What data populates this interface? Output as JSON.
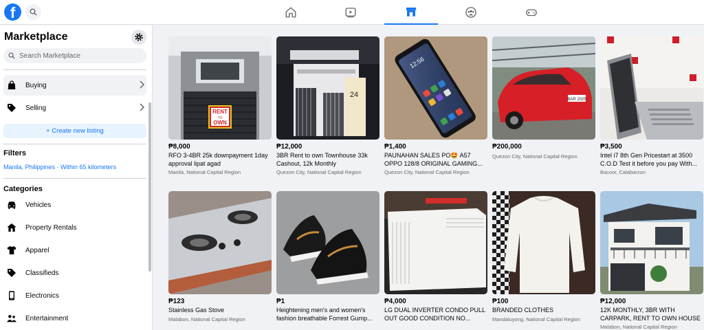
{
  "sidebar": {
    "title": "Marketplace",
    "search_placeholder": "Search Marketplace",
    "nav": [
      {
        "label": "Buying"
      },
      {
        "label": "Selling"
      }
    ],
    "create_listing": "+ Create new listing",
    "filters_heading": "Filters",
    "location": "Manila, Philippines · Within 65 kilometers",
    "categories_heading": "Categories",
    "categories": [
      {
        "label": "Vehicles",
        "icon": "car-icon"
      },
      {
        "label": "Property Rentals",
        "icon": "house-icon"
      },
      {
        "label": "Apparel",
        "icon": "shirt-icon"
      },
      {
        "label": "Classifieds",
        "icon": "tag-icon"
      },
      {
        "label": "Electronics",
        "icon": "phone-icon"
      },
      {
        "label": "Entertainment",
        "icon": "people-icon"
      }
    ]
  },
  "nav_tabs": [
    "home",
    "watch",
    "marketplace",
    "groups",
    "gaming"
  ],
  "colors": {
    "accent": "#1877f2",
    "page_bg": "#f0f2f5",
    "secondary_text": "#65676b"
  },
  "listings": [
    {
      "price": "₱8,000",
      "title": "RFO 3-4BR 25k downpayment 1day approval lipat agad",
      "location": "Manila, National Capital Region",
      "sign_line1": "RENT",
      "sign_line2": "TO",
      "sign_line3": "OWN"
    },
    {
      "price": "₱12,000",
      "title": "3BR Rent to own Townhouse 33k Cashout, 12k Monthly",
      "location": "Quezon City, National Capital Region",
      "house_number": "24"
    },
    {
      "price": "₱1,400",
      "title": "PAUNAHAN SALES PO🤩 A57 OPPO 128/8 ORIGINAL GAMING...",
      "location": "Quezon City, National Capital Region",
      "phone_time": "12:56"
    },
    {
      "price": "₱200,000",
      "title": "Quezon City, National Capital Region",
      "location": "",
      "plate": "BAR 2025"
    },
    {
      "price": "₱3,500",
      "title": "Intel i7 8th Gen Pricestart at 3500 C.O.D Test it before you pay With...",
      "location": "Bacoor, Calabarzon"
    },
    {
      "price": "₱123",
      "title": "Stainless Gas Stove",
      "location": "Malabon, National Capital Region"
    },
    {
      "price": "₱1",
      "title": "Heightening men's and women's fashion breathable Forrest Gump...",
      "location": ""
    },
    {
      "price": "₱4,000",
      "title": "LG DUAL INVERTER CONDO PULL OUT GOOD CONDITION NO...",
      "location": ""
    },
    {
      "price": "₱100",
      "title": "BRANDED CLOTHES",
      "location": "Mandaluyong, National Capital Region"
    },
    {
      "price": "₱12,000",
      "title": "12K MONTHLY, 3BR WITH CARPARK, RENT TO OWN HOUSE ...",
      "location": "Malabon, National Capital Region"
    }
  ]
}
